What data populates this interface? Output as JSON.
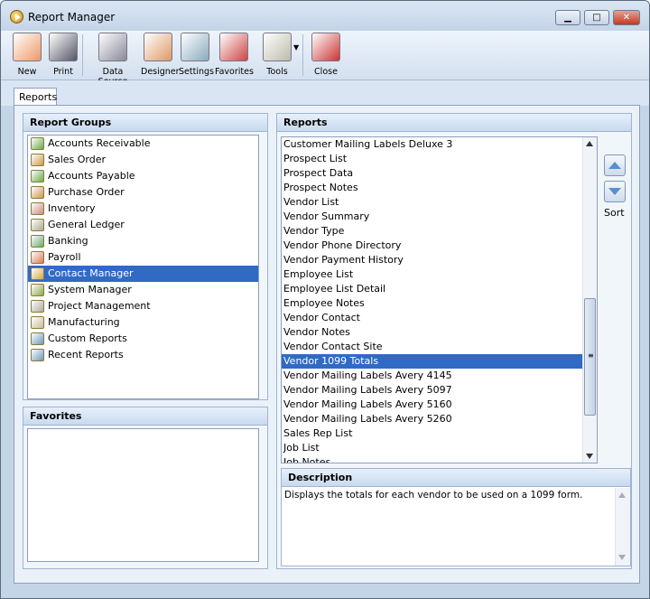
{
  "window": {
    "title": "Report Manager"
  },
  "toolbar": {
    "items": [
      {
        "label": "New",
        "icon": "new-report-icon"
      },
      {
        "label": "Print",
        "icon": "printer-icon"
      },
      {
        "label": "Data Source",
        "icon": "database-icon"
      },
      {
        "label": "Designer",
        "icon": "designer-icon"
      },
      {
        "label": "Settings",
        "icon": "settings-icon"
      },
      {
        "label": "Favorites",
        "icon": "favorites-icon"
      },
      {
        "label": "Tools",
        "icon": "tools-icon"
      },
      {
        "label": "Close",
        "icon": "close-report-icon"
      }
    ]
  },
  "tabs": [
    {
      "label": "Reports",
      "active": true
    }
  ],
  "report_groups": {
    "title": "Report Groups",
    "selected": "Contact Manager",
    "items": [
      "Accounts Receivable",
      "Sales Order",
      "Accounts Payable",
      "Purchase Order",
      "Inventory",
      "General Ledger",
      "Banking",
      "Payroll",
      "Contact Manager",
      "System Manager",
      "Project Management",
      "Manufacturing",
      "Custom Reports",
      "Recent Reports"
    ]
  },
  "favorites": {
    "title": "Favorites",
    "items": []
  },
  "reports": {
    "title": "Reports",
    "selected": "Vendor 1099 Totals",
    "items": [
      "Customer Mailing Labels Deluxe 3",
      "Prospect List",
      "Prospect Data",
      "Prospect Notes",
      "Vendor List",
      "Vendor Summary",
      "Vendor Type",
      "Vendor Phone Directory",
      "Vendor Payment History",
      "Employee List",
      "Employee List Detail",
      "Employee Notes",
      "Vendor Contact",
      "Vendor Notes",
      "Vendor Contact Site",
      "Vendor 1099 Totals",
      "Vendor Mailing Labels Avery 4145",
      "Vendor Mailing Labels Avery 5097",
      "Vendor Mailing Labels Avery 5160",
      "Vendor Mailing Labels Avery 5260",
      "Sales Rep List",
      "Job List",
      "Job Notes"
    ]
  },
  "sort": {
    "label": "Sort"
  },
  "description": {
    "title": "Description",
    "text": "Displays the totals for each vendor to be used on a 1099 form."
  },
  "colors": {
    "selection": "#316ac5",
    "header": "#c8daef"
  }
}
